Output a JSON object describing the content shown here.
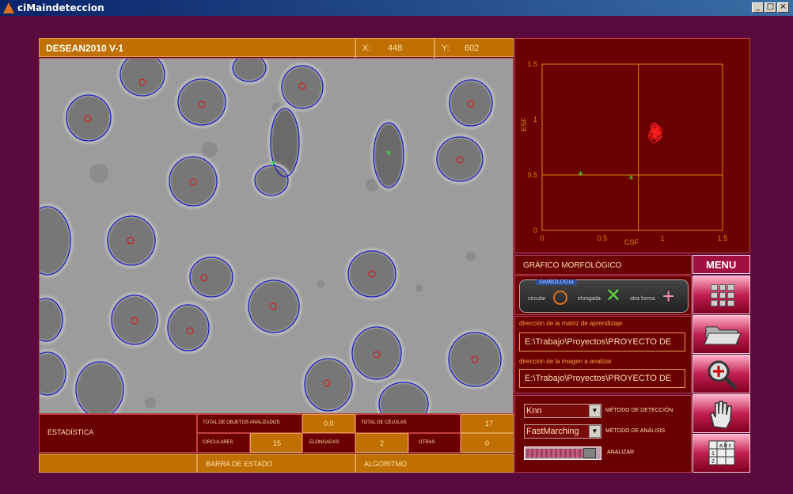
{
  "window": {
    "title": "ciMaindeteccion"
  },
  "header": {
    "app_title": "DESEAN2010 V-1",
    "x_label": "X:",
    "x_value": "448",
    "y_label": "Y:",
    "y_value": "602"
  },
  "chart_data": {
    "type": "scatter",
    "title": "",
    "xlabel": "CSF",
    "ylabel": "ESF",
    "xlim": [
      0,
      1.5
    ],
    "ylim": [
      0,
      1.5
    ],
    "xticks": [
      "0",
      "0.5",
      "1",
      "1.5"
    ],
    "yticks": [
      "0",
      "0.5",
      "1",
      "1.5"
    ],
    "crosshair": {
      "x": 0.8,
      "y": 0.5
    },
    "series": [
      {
        "marker": "circle",
        "color": "#ff2020",
        "x": [
          0.92,
          0.93,
          0.95,
          0.96,
          0.94,
          0.91,
          0.97,
          0.93,
          0.95,
          0.92,
          0.96,
          0.94,
          0.93,
          0.95,
          0.97
        ],
        "y": [
          0.88,
          0.91,
          0.86,
          0.89,
          0.93,
          0.85,
          0.9,
          0.82,
          0.92,
          0.87,
          0.84,
          0.89,
          0.94,
          0.88,
          0.86
        ]
      },
      {
        "marker": "star",
        "color": "#30ff30",
        "x": [
          0.32,
          0.74
        ],
        "y": [
          0.5,
          0.46
        ]
      }
    ]
  },
  "morph": {
    "label": "GRÁFICO MORFOLÓGICO"
  },
  "menu": {
    "label": "MENU"
  },
  "legend": {
    "title": "SIMBOLOGIA",
    "circular": "circular",
    "elongada": "elongada",
    "otra": "otra forma"
  },
  "paths": {
    "matrix_label": "dirección de la matriz de aprendizaje",
    "matrix_value": "E:\\Trabajo\\Proyectos\\PROYECTO DE",
    "image_label": "dirección de la imagen a analizar",
    "image_value": "E:\\Trabajo\\Proyectos\\PROYECTO DE"
  },
  "controls": {
    "detect_value": "Knn",
    "detect_label": "MÉTODO DE DETECCIÓN",
    "analysis_value": "FastMarching",
    "analysis_label": "MÉTODO DE ANÁLISIS",
    "analyze_label": "ANALIZAR"
  },
  "stats": {
    "title": "ESTADÍSTICA",
    "total_obj_label": "TOTAL DE OBJETOS ANALIZADOS",
    "total_obj_value": "0.0",
    "total_cel_label": "TOTAL DE CÉLULAS",
    "total_cel_value": "17",
    "circ_label": "CIRCULARES",
    "circ_value": "15",
    "elong_label": "ELONGADAS",
    "elong_value": "2",
    "otras_label": "OTRAS",
    "otras_value": "0"
  },
  "status": {
    "bar_label": "BARRA DE ESTADO",
    "algo_label": "ALGORITMO"
  },
  "colors": {
    "background": "#5a0a3c",
    "panel": "#6a0000",
    "orange": "#c07000",
    "accent": "#ffe0b0"
  }
}
